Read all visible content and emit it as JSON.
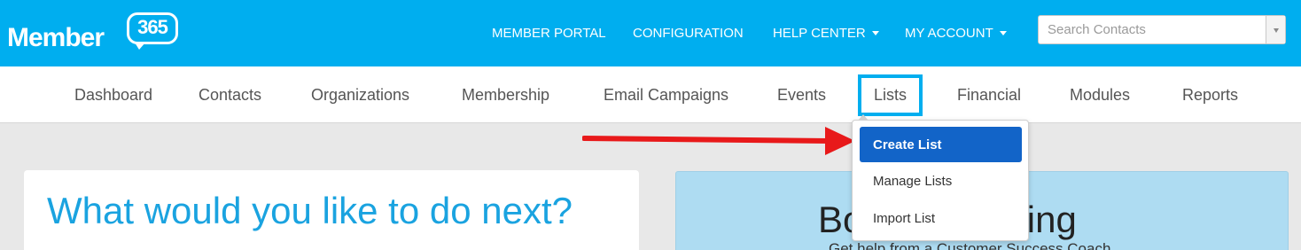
{
  "brand": {
    "name": "Member",
    "number": "365"
  },
  "topnav": {
    "member_portal": "MEMBER PORTAL",
    "configuration": "CONFIGURATION",
    "help_center": "HELP CENTER",
    "my_account": "MY ACCOUNT"
  },
  "search": {
    "placeholder": "Search Contacts"
  },
  "subnav": {
    "items": [
      "Dashboard",
      "Contacts",
      "Organizations",
      "Membership",
      "Email Campaigns",
      "Events",
      "Lists",
      "Financial",
      "Modules",
      "Reports"
    ],
    "active": "Lists"
  },
  "lists_menu": {
    "items": [
      "Create List",
      "Manage Lists",
      "Import List"
    ],
    "highlighted": "Create List"
  },
  "left_card": {
    "heading": "What would you like to do next?"
  },
  "right_card": {
    "title": "Book a Meeting",
    "subtitle": "Get help from a Customer Success Coach"
  },
  "colors": {
    "topbar": "#00aeef",
    "highlight": "#1264c8",
    "annotation_arrow": "#e8191a",
    "right_card_bg": "#aedcf2"
  },
  "icons": {
    "caret": "caret-down-icon",
    "search_dropdown": "chevron-down-icon",
    "annotation": "red-arrow-icon"
  }
}
